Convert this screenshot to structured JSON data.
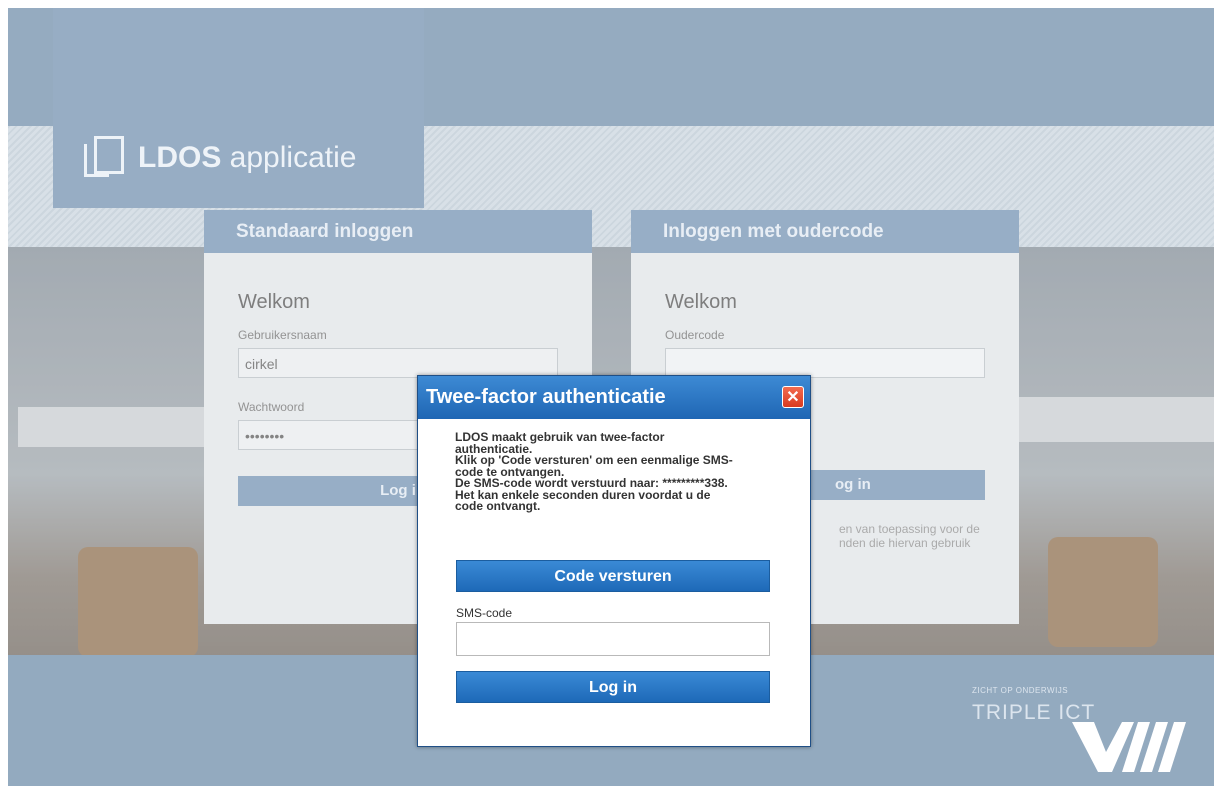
{
  "logo": {
    "bold": "LDOS",
    "regular": " applicatie",
    "icon": "documents-icon"
  },
  "standard_panel": {
    "title": "Standaard inloggen",
    "welcome": "Welkom",
    "username_label": "Gebruikersnaam",
    "username_value": "cirkel",
    "password_label": "Wachtwoord",
    "password_value": "••••••••",
    "login_label": "Log i"
  },
  "parent_panel": {
    "title": "Inloggen met oudercode",
    "welcome": "Welkom",
    "code_label": "Oudercode",
    "login_label": "og in",
    "text_line1": "en van toepassing voor de",
    "text_line2": "nden die hiervan gebruik"
  },
  "modal": {
    "title": "Twee-factor authenticatie",
    "close_icon": "close-icon",
    "text_lines": [
      "LDOS maakt gebruik van twee-factor",
      "authenticatie.",
      "Klik op 'Code versturen' om een eenmalige SMS-",
      "code te ontvangen.",
      "De SMS-code wordt verstuurd naar: *********338.",
      "Het kan enkele seconden duren voordat u de",
      "code ontvangt."
    ],
    "send_button": "Code versturen",
    "sms_label": "SMS-code",
    "sms_value": "",
    "login_button": "Log in"
  },
  "brand": {
    "tagline": "ZICHT OP ONDERWIJS",
    "name": "TRIPLE ICT"
  }
}
